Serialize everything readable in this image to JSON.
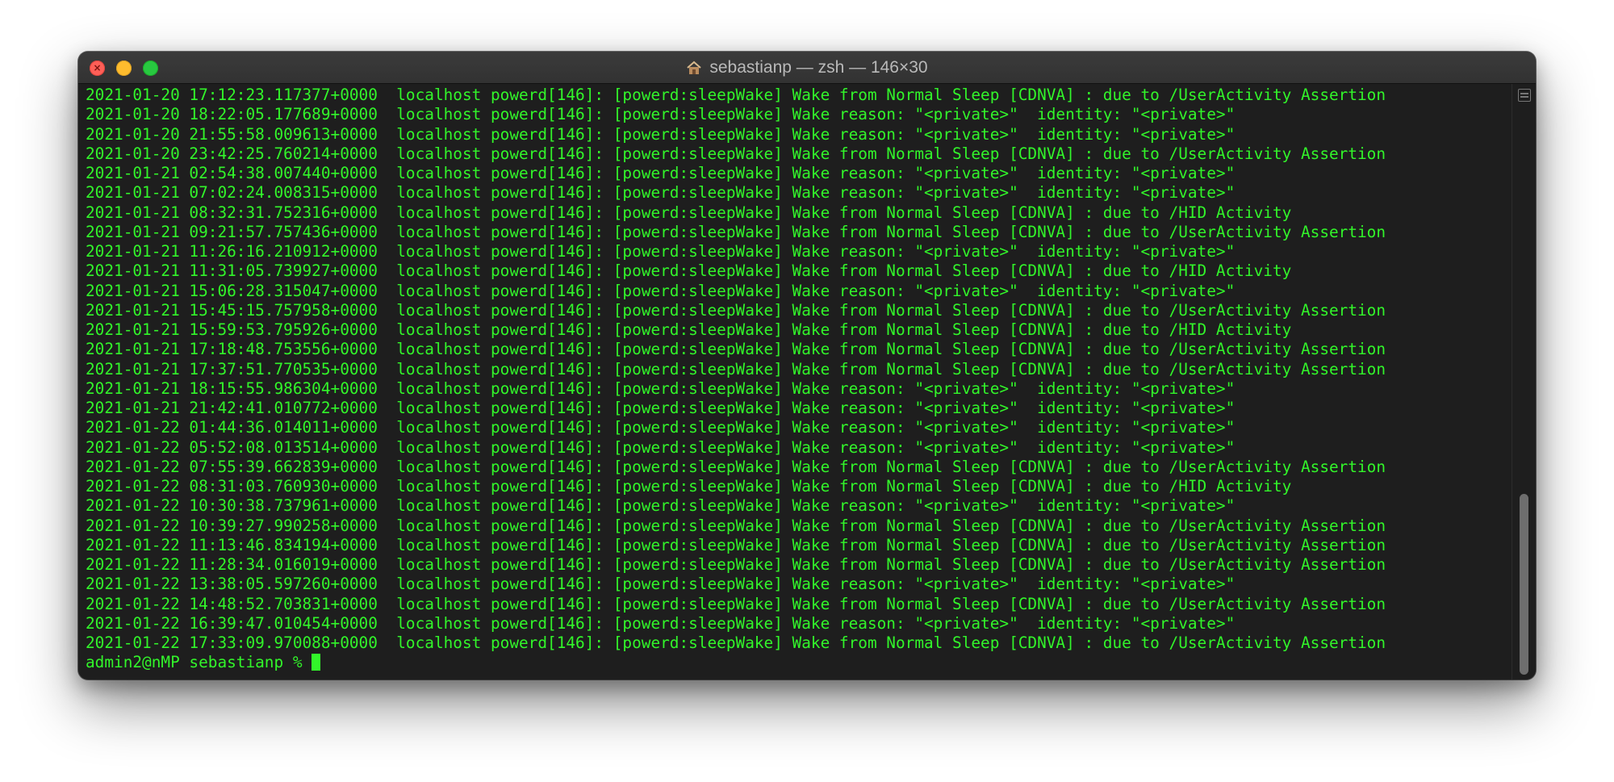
{
  "window": {
    "title": "sebastianp — zsh — 146×30"
  },
  "colors": {
    "terminal_text": "#32f52a",
    "terminal_background": "#1e1e1e",
    "close": "#fe5f57",
    "minimize": "#febc2e",
    "zoom": "#28c840"
  },
  "icons": {
    "title": "home-folder-icon",
    "close": "close-icon",
    "minimize": "minimize-icon",
    "zoom": "zoom-icon",
    "scroll": "scroll-menu-icon"
  },
  "terminal": {
    "lines": [
      "2021-01-20 17:12:23.117377+0000  localhost powerd[146]: [powerd:sleepWake] Wake from Normal Sleep [CDNVA] : due to /UserActivity Assertion",
      "2021-01-20 18:22:05.177689+0000  localhost powerd[146]: [powerd:sleepWake] Wake reason: \"<private>\"  identity: \"<private>\"",
      "2021-01-20 21:55:58.009613+0000  localhost powerd[146]: [powerd:sleepWake] Wake reason: \"<private>\"  identity: \"<private>\"",
      "2021-01-20 23:42:25.760214+0000  localhost powerd[146]: [powerd:sleepWake] Wake from Normal Sleep [CDNVA] : due to /UserActivity Assertion",
      "2021-01-21 02:54:38.007440+0000  localhost powerd[146]: [powerd:sleepWake] Wake reason: \"<private>\"  identity: \"<private>\"",
      "2021-01-21 07:02:24.008315+0000  localhost powerd[146]: [powerd:sleepWake] Wake reason: \"<private>\"  identity: \"<private>\"",
      "2021-01-21 08:32:31.752316+0000  localhost powerd[146]: [powerd:sleepWake] Wake from Normal Sleep [CDNVA] : due to /HID Activity",
      "2021-01-21 09:21:57.757436+0000  localhost powerd[146]: [powerd:sleepWake] Wake from Normal Sleep [CDNVA] : due to /UserActivity Assertion",
      "2021-01-21 11:26:16.210912+0000  localhost powerd[146]: [powerd:sleepWake] Wake reason: \"<private>\"  identity: \"<private>\"",
      "2021-01-21 11:31:05.739927+0000  localhost powerd[146]: [powerd:sleepWake] Wake from Normal Sleep [CDNVA] : due to /HID Activity",
      "2021-01-21 15:06:28.315047+0000  localhost powerd[146]: [powerd:sleepWake] Wake reason: \"<private>\"  identity: \"<private>\"",
      "2021-01-21 15:45:15.757958+0000  localhost powerd[146]: [powerd:sleepWake] Wake from Normal Sleep [CDNVA] : due to /UserActivity Assertion",
      "2021-01-21 15:59:53.795926+0000  localhost powerd[146]: [powerd:sleepWake] Wake from Normal Sleep [CDNVA] : due to /HID Activity",
      "2021-01-21 17:18:48.753556+0000  localhost powerd[146]: [powerd:sleepWake] Wake from Normal Sleep [CDNVA] : due to /UserActivity Assertion",
      "2021-01-21 17:37:51.770535+0000  localhost powerd[146]: [powerd:sleepWake] Wake from Normal Sleep [CDNVA] : due to /UserActivity Assertion",
      "2021-01-21 18:15:55.986304+0000  localhost powerd[146]: [powerd:sleepWake] Wake reason: \"<private>\"  identity: \"<private>\"",
      "2021-01-21 21:42:41.010772+0000  localhost powerd[146]: [powerd:sleepWake] Wake reason: \"<private>\"  identity: \"<private>\"",
      "2021-01-22 01:44:36.014011+0000  localhost powerd[146]: [powerd:sleepWake] Wake reason: \"<private>\"  identity: \"<private>\"",
      "2021-01-22 05:52:08.013514+0000  localhost powerd[146]: [powerd:sleepWake] Wake reason: \"<private>\"  identity: \"<private>\"",
      "2021-01-22 07:55:39.662839+0000  localhost powerd[146]: [powerd:sleepWake] Wake from Normal Sleep [CDNVA] : due to /UserActivity Assertion",
      "2021-01-22 08:31:03.760930+0000  localhost powerd[146]: [powerd:sleepWake] Wake from Normal Sleep [CDNVA] : due to /HID Activity",
      "2021-01-22 10:30:38.737961+0000  localhost powerd[146]: [powerd:sleepWake] Wake reason: \"<private>\"  identity: \"<private>\"",
      "2021-01-22 10:39:27.990258+0000  localhost powerd[146]: [powerd:sleepWake] Wake from Normal Sleep [CDNVA] : due to /UserActivity Assertion",
      "2021-01-22 11:13:46.834194+0000  localhost powerd[146]: [powerd:sleepWake] Wake from Normal Sleep [CDNVA] : due to /UserActivity Assertion",
      "2021-01-22 11:28:34.016019+0000  localhost powerd[146]: [powerd:sleepWake] Wake from Normal Sleep [CDNVA] : due to /UserActivity Assertion",
      "2021-01-22 13:38:05.597260+0000  localhost powerd[146]: [powerd:sleepWake] Wake reason: \"<private>\"  identity: \"<private>\"",
      "2021-01-22 14:48:52.703831+0000  localhost powerd[146]: [powerd:sleepWake] Wake from Normal Sleep [CDNVA] : due to /UserActivity Assertion",
      "2021-01-22 16:39:47.010454+0000  localhost powerd[146]: [powerd:sleepWake] Wake reason: \"<private>\"  identity: \"<private>\"",
      "2021-01-22 17:33:09.970088+0000  localhost powerd[146]: [powerd:sleepWake] Wake from Normal Sleep [CDNVA] : due to /UserActivity Assertion"
    ],
    "prompt": "admin2@nMP sebastianp % "
  }
}
